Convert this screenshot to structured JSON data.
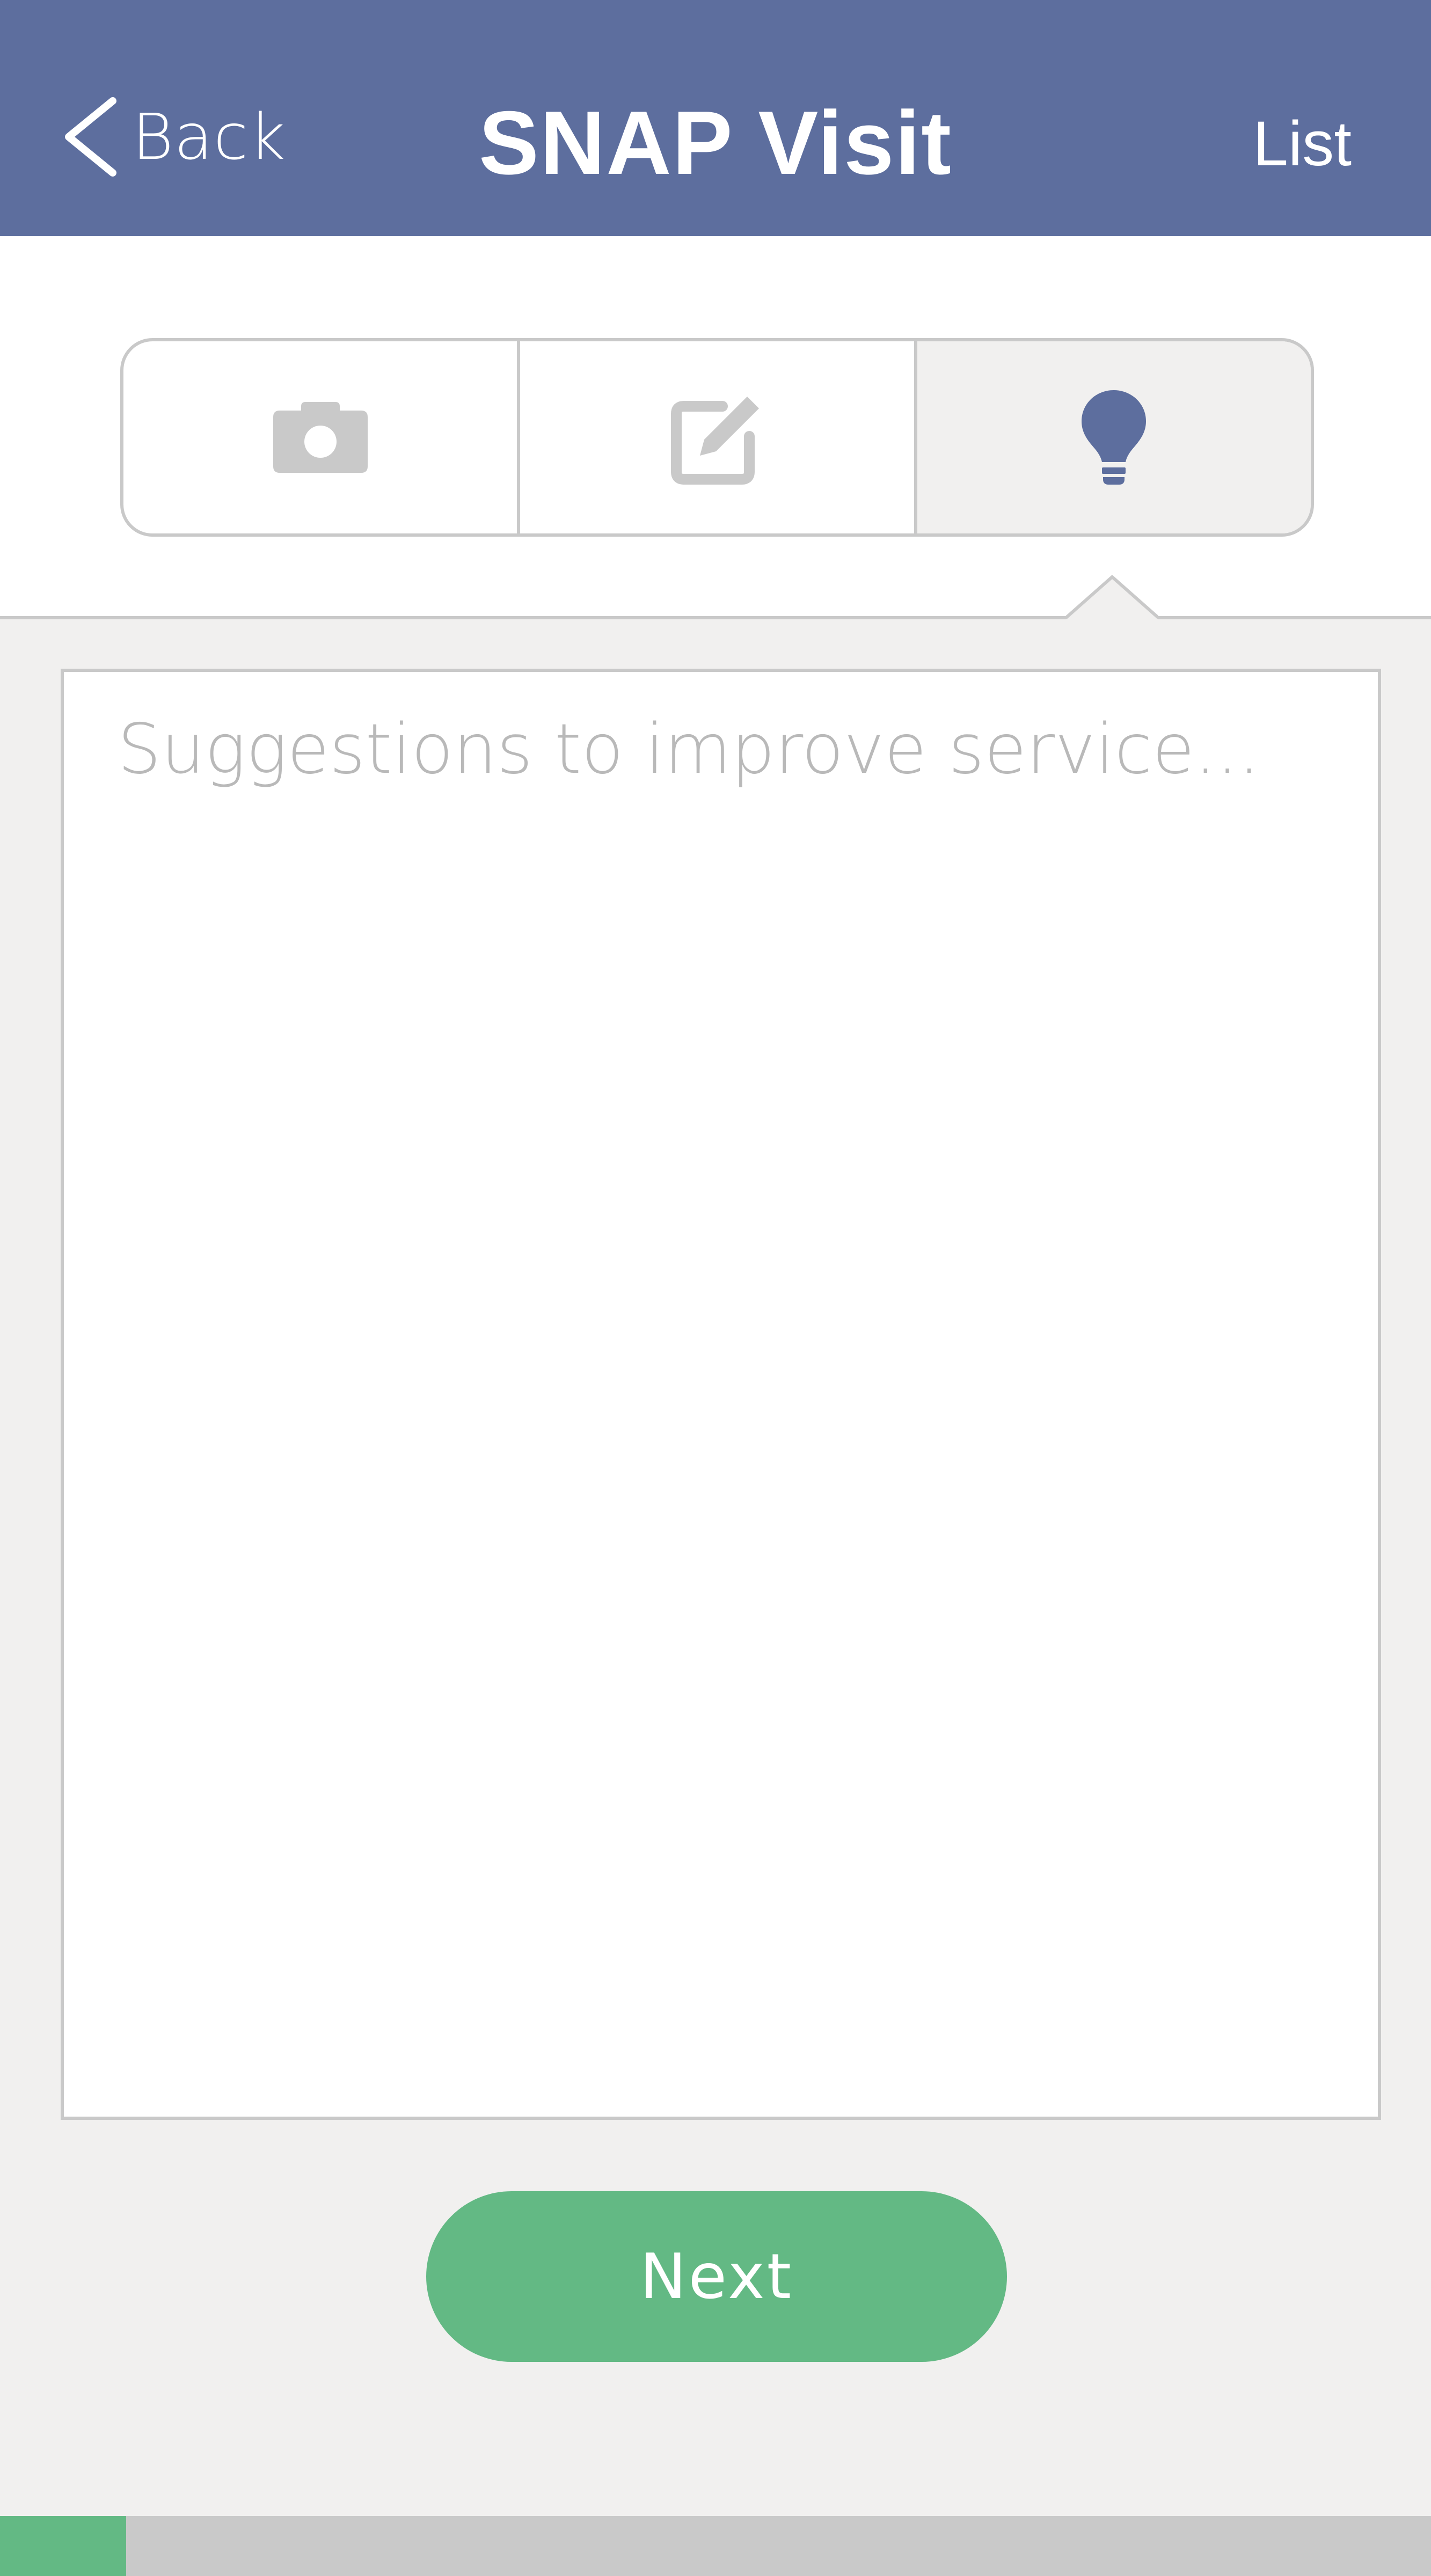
{
  "header": {
    "back_label": "Back",
    "title": "SNAP Visit",
    "list_label": "List"
  },
  "tabs": [
    {
      "icon": "camera-icon",
      "active": false
    },
    {
      "icon": "edit-icon",
      "active": false
    },
    {
      "icon": "lightbulb-icon",
      "active": true
    }
  ],
  "suggestions": {
    "placeholder": "Suggestions to improve service...",
    "value": ""
  },
  "next_label": "Next",
  "progress": {
    "fraction": 0.088
  },
  "colors": {
    "header_bg": "#5d6e9e",
    "accent_green": "#63b984",
    "icon_inactive": "#c9c9c9",
    "icon_active": "#5d6e9e",
    "panel_bg": "#f1f0ef"
  }
}
